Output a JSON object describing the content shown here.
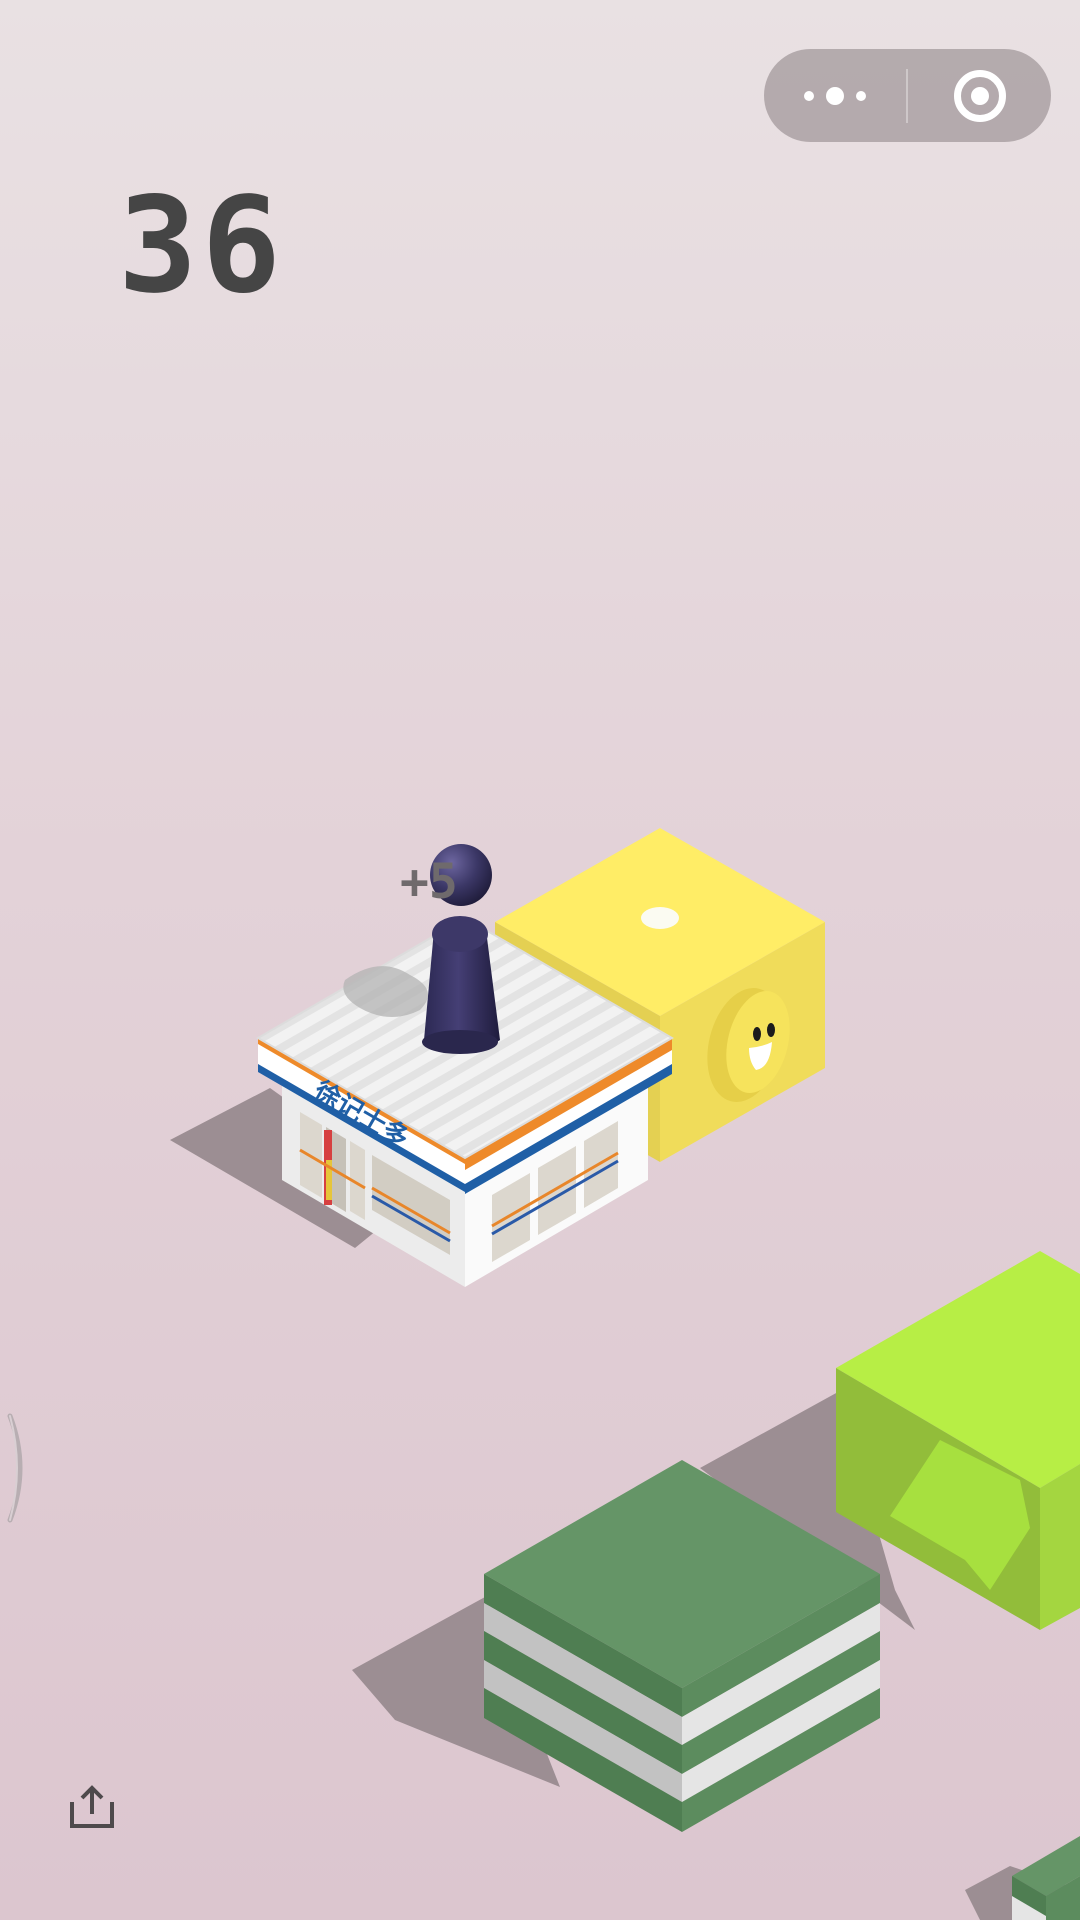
{
  "game": {
    "score": "36",
    "bonus": "+5",
    "store_sign": "徐记士多"
  },
  "colors": {
    "background_top": "#e9e1e3",
    "background_bottom": "#dcc6cf",
    "score_text": "#454545",
    "yellow_block_top": "#ffed66",
    "green_block_top": "#659567",
    "lime_block_top": "#b7ee45",
    "player_piece": "#3b3766"
  },
  "icons": {
    "menu": "more-dots-icon",
    "close": "target-circle-icon",
    "share": "share-icon"
  }
}
